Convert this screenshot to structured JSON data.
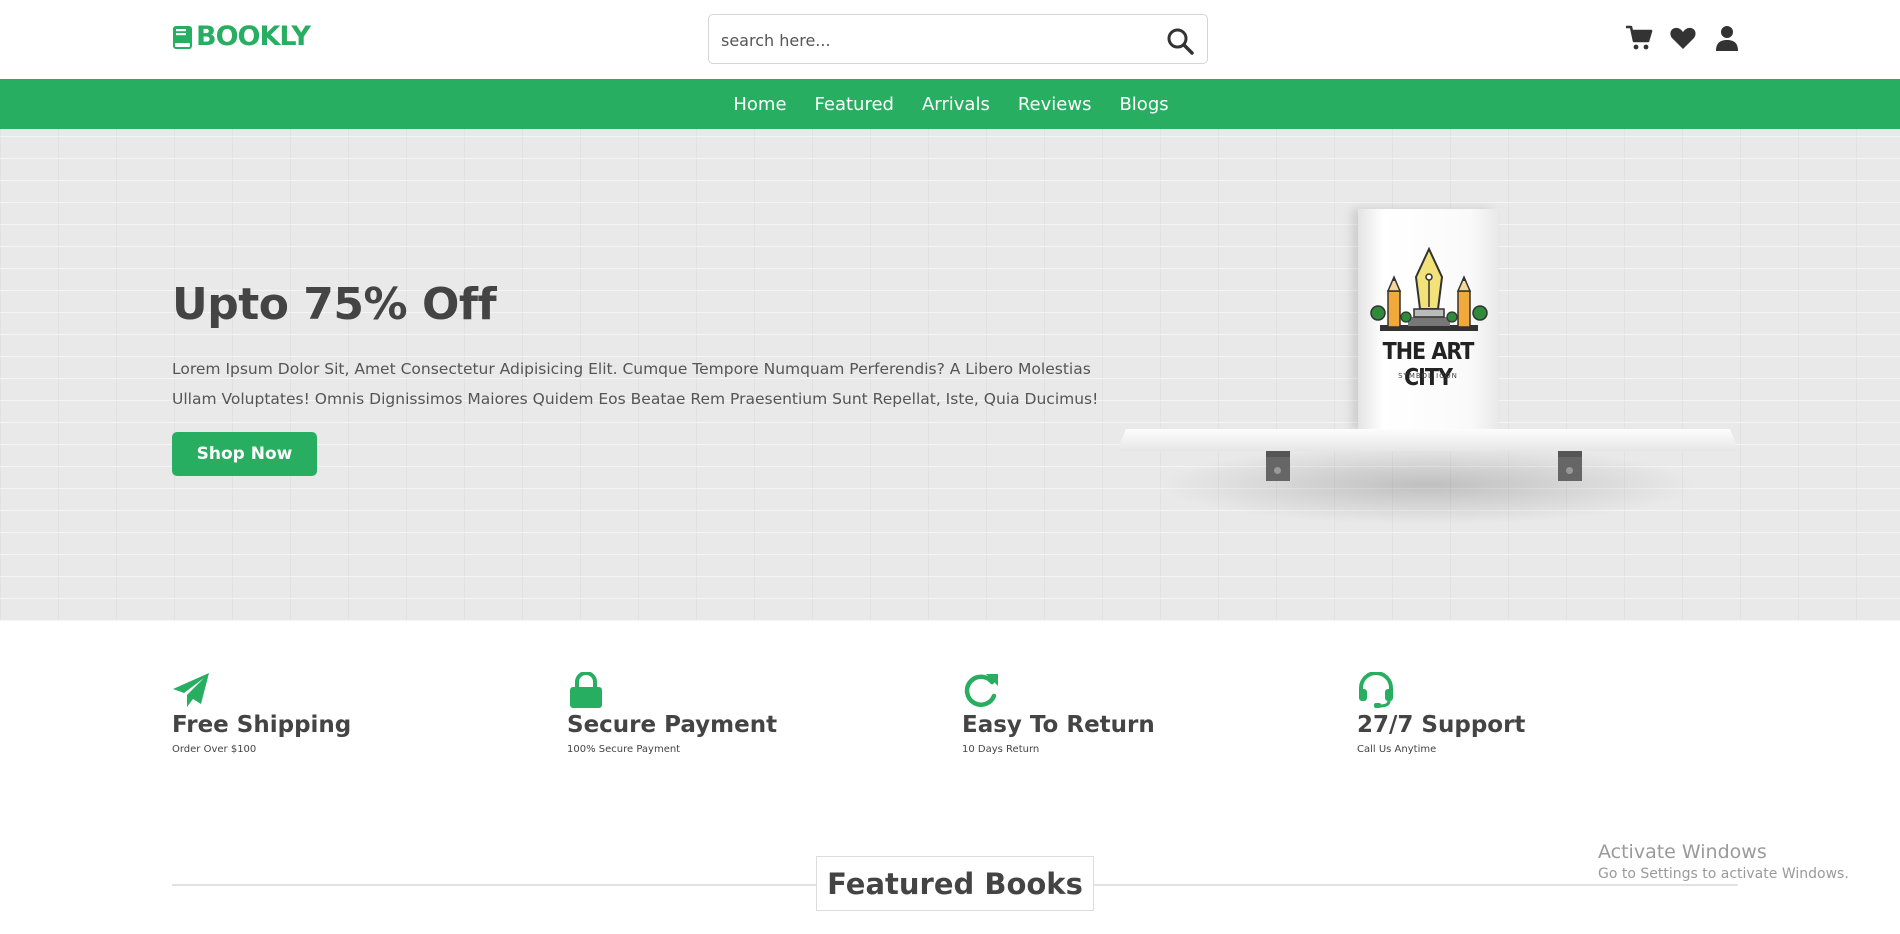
{
  "header": {
    "logo_text": "BOOKLY",
    "search_placeholder": "search here...",
    "icons": [
      "cart-icon",
      "heart-icon",
      "user-icon"
    ]
  },
  "nav": {
    "items": [
      "Home",
      "Featured",
      "Arrivals",
      "Reviews",
      "Blogs"
    ]
  },
  "hero": {
    "title": "Upto 75% Off",
    "text": "Lorem Ipsum Dolor Sit, Amet Consectetur Adipisicing Elit. Cumque Tempore Numquam Perferendis? A Libero Molestias Ullam Voluptates! Omnis Dignissimos Maiores Quidem Eos Beatae Rem Praesentium Sunt Repellat, Iste, Quia Ducimus!",
    "button": "Shop Now",
    "book_title": "THE ART CITY",
    "book_subtitle": "SYMBOL ICON"
  },
  "features": [
    {
      "icon": "paper-plane-icon",
      "title": "Free Shipping",
      "subtitle": "Order Over $100"
    },
    {
      "icon": "lock-icon",
      "title": "Secure Payment",
      "subtitle": "100% Secure Payment"
    },
    {
      "icon": "redo-icon",
      "title": "Easy To Return",
      "subtitle": "10 Days Return"
    },
    {
      "icon": "headset-icon",
      "title": "27/7 Support",
      "subtitle": "Call Us Anytime"
    }
  ],
  "featured_heading": "Featured Books",
  "watermark": {
    "line1": "Activate Windows",
    "line2": "Go to Settings to activate Windows."
  },
  "colors": {
    "accent": "#27ae60",
    "text": "#444444",
    "hero_bg": "#e9e9e9"
  }
}
